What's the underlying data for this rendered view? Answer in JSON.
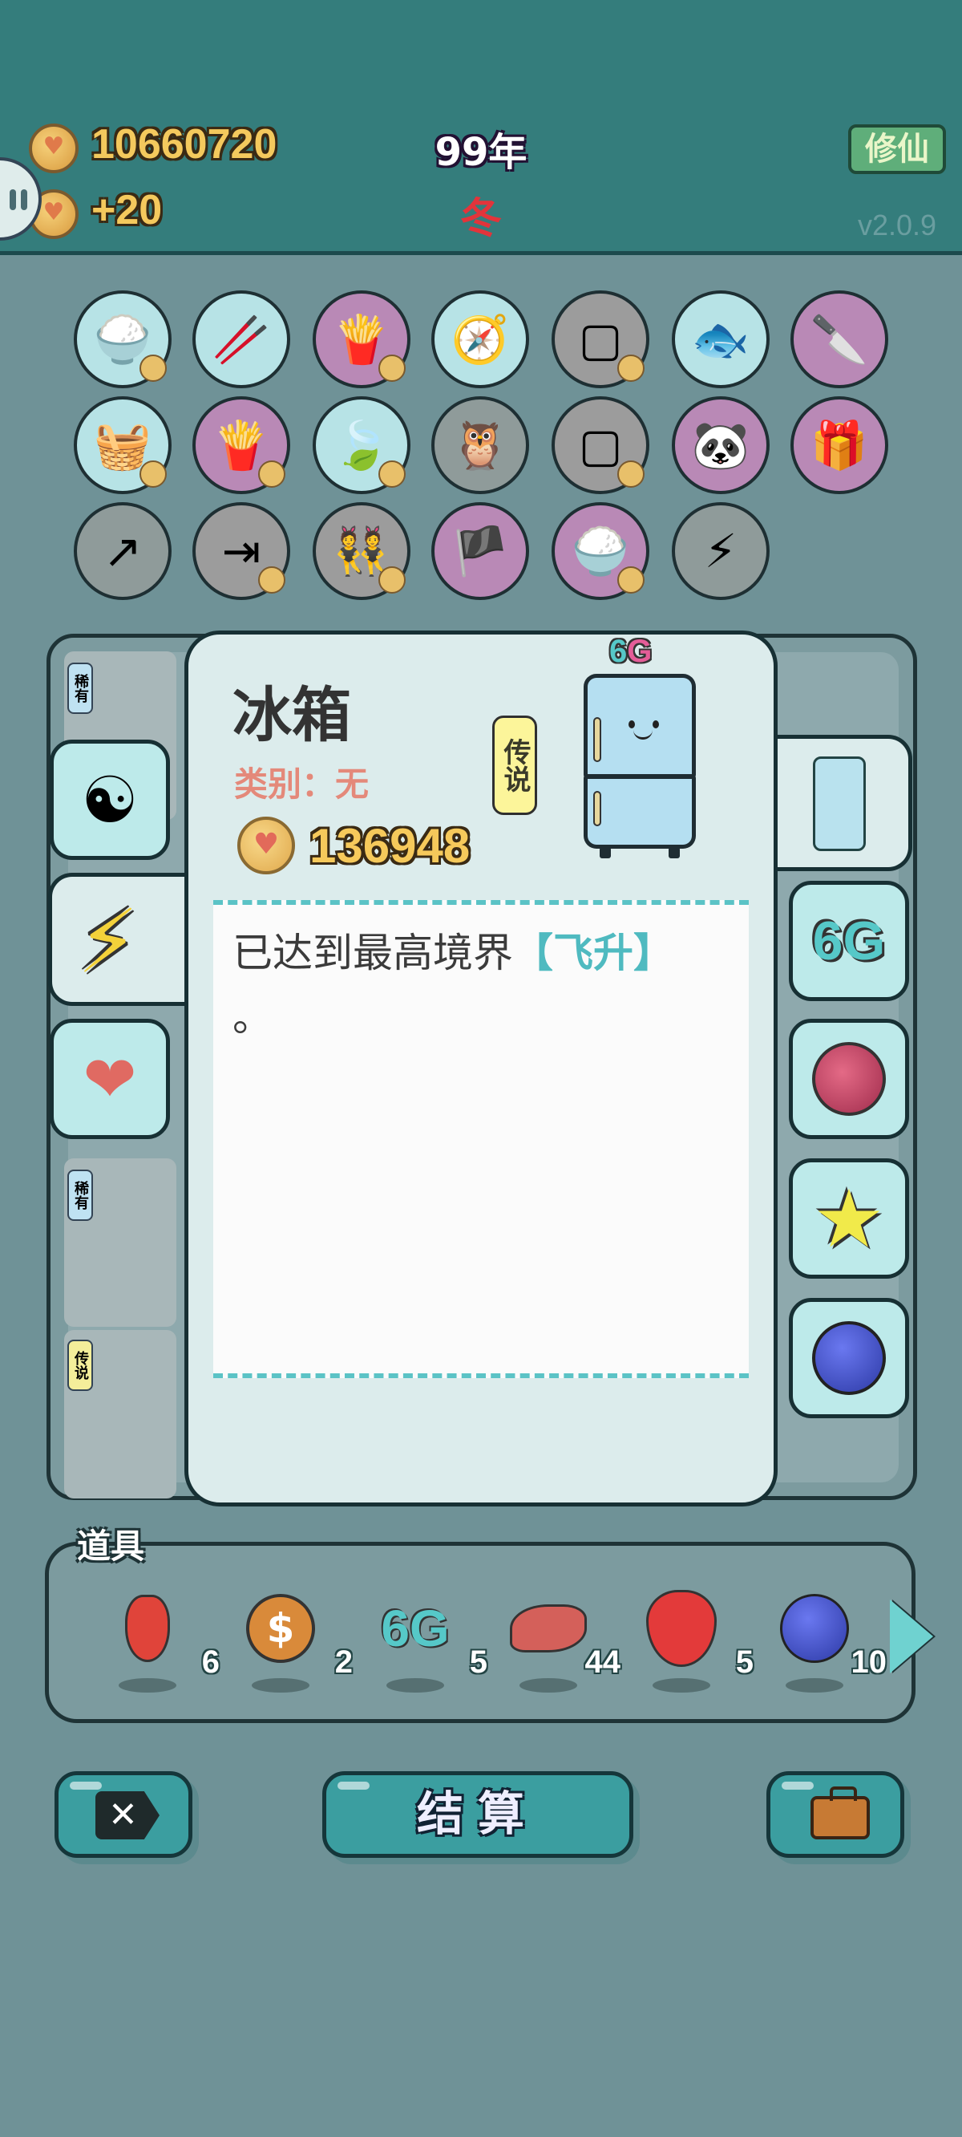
{
  "header": {
    "gold": "10660720",
    "income": "+20",
    "year": "99年",
    "season": "冬",
    "mode_button": "修仙",
    "version": "v2.0.9"
  },
  "item_detail": {
    "name": "冰箱",
    "category": "类别：无",
    "rarity": "传说",
    "price": "136948",
    "badge_six": "6",
    "badge_g": "G",
    "description_prefix": "已达到最高境界",
    "description_highlight": "【飞升】",
    "description_suffix": "。"
  },
  "board_tags": {
    "tag1": "稀有",
    "tag2": "稀有",
    "tag3": "传说",
    "side_label": "6G"
  },
  "props": {
    "label": "道具",
    "items": [
      {
        "icon": "chili-icon",
        "count": "6"
      },
      {
        "icon": "coin-icon",
        "count": "2"
      },
      {
        "icon": "6g-icon",
        "count": "5"
      },
      {
        "icon": "liver-icon",
        "count": "44"
      },
      {
        "icon": "strawberry-icon",
        "count": "5"
      },
      {
        "icon": "blueberry-icon",
        "count": "10"
      }
    ]
  },
  "buttons": {
    "settle": "结算"
  },
  "colors": {
    "header_bg": "#347d7c",
    "accent_teal": "#4fbac0",
    "gold_text": "#f4c95d",
    "season_red": "#e2343b"
  }
}
